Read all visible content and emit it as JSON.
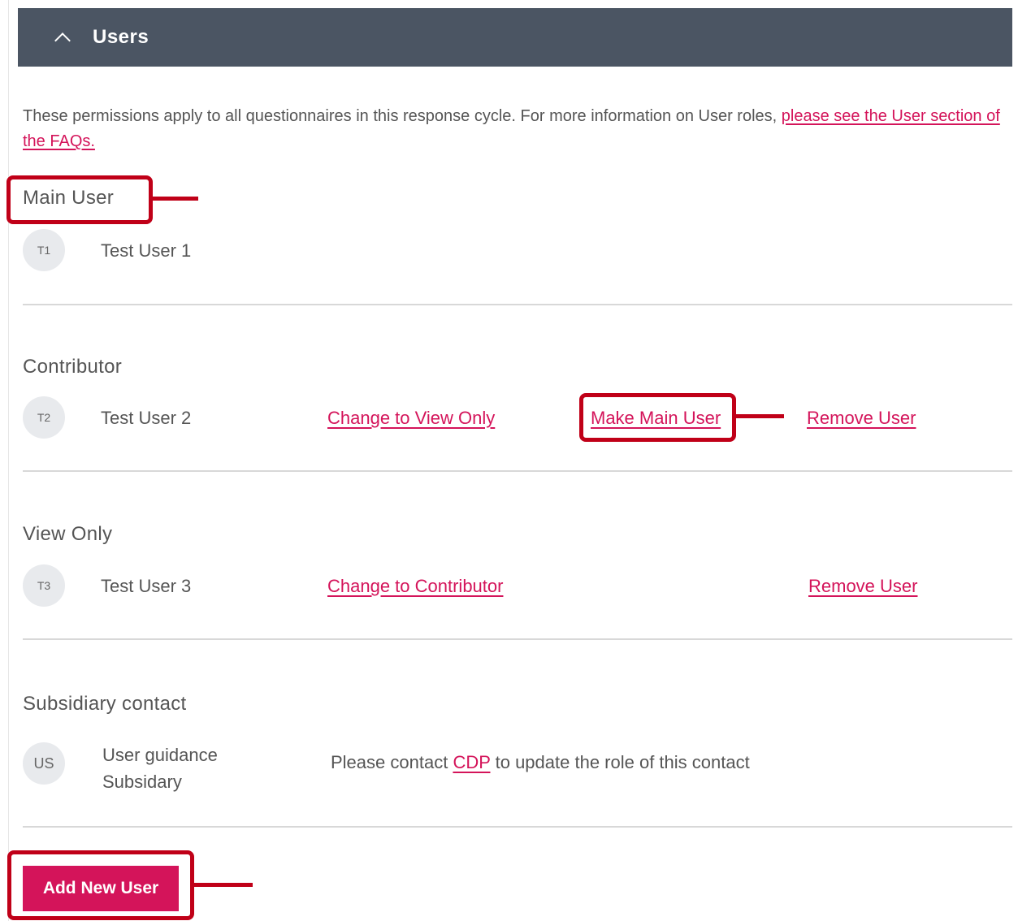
{
  "header": {
    "title": "Users",
    "toggle_icon": "chevron-up-icon"
  },
  "intro": {
    "text": "These permissions apply to all questionnaires in this response cycle. For more information on User roles, ",
    "link_label": "please see the User section of the FAQs."
  },
  "sections": {
    "main_user": {
      "title": "Main User",
      "users": [
        {
          "initials": "T1",
          "name": "Test User 1"
        }
      ]
    },
    "contributor": {
      "title": "Contributor",
      "users": [
        {
          "initials": "T2",
          "name": "Test User 2",
          "change_label": "Change to View Only",
          "make_main_label": "Make Main User",
          "remove_label": "Remove User"
        }
      ]
    },
    "view_only": {
      "title": "View Only",
      "users": [
        {
          "initials": "T3",
          "name": "Test User 3",
          "change_label": "Change to Contributor",
          "remove_label": "Remove User"
        }
      ]
    },
    "subsidiary": {
      "title": "Subsidiary contact",
      "users": [
        {
          "initials": "US",
          "name_line1": "User guidance",
          "name_line2": "Subsidary"
        }
      ],
      "note_prefix": "Please contact ",
      "note_link": "CDP",
      "note_suffix": " to update the role of this contact"
    }
  },
  "add_button": {
    "label": "Add New User"
  },
  "colors": {
    "header_bg": "#4b5563",
    "accent": "#d4145a",
    "callout": "#c00018"
  }
}
